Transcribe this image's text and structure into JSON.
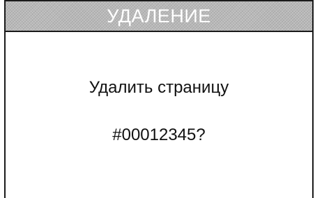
{
  "dialog": {
    "title": "УДАЛЕНИЕ",
    "message_line_1": "Удалить страницу",
    "message_line_2": "#00012345?"
  },
  "colors": {
    "title_bar_background": "#b9b9b9",
    "title_text": "#ffffff",
    "border": "#1a1a1a",
    "body_background": "#ffffff",
    "message_text": "#111111"
  }
}
